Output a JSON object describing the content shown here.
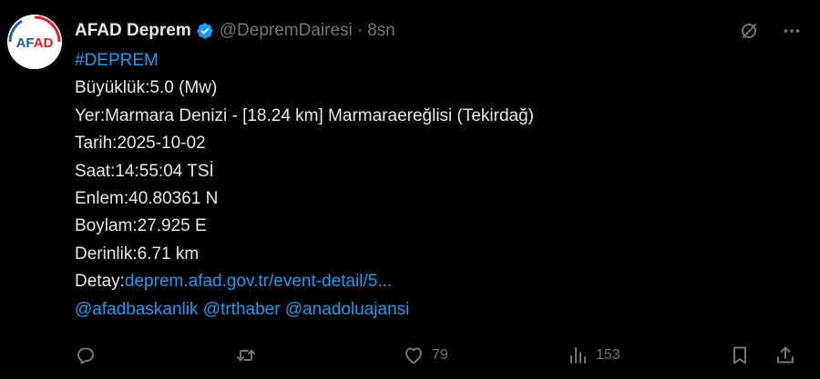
{
  "author": {
    "avatar_text": "AFAD",
    "display_name": "AFAD Deprem",
    "handle": "@DepremDairesi",
    "separator": "·",
    "time": "8sn"
  },
  "tweet": {
    "hashtag": "#DEPREM",
    "magnitude": "Büyüklük:5.0 (Mw)",
    "location": "Yer:Marmara Denizi - [18.24 km] Marmaraereğlisi (Tekirdağ)",
    "date": "Tarih:2025-10-02",
    "time": "Saat:14:55:04 TSİ",
    "latitude": "Enlem:40.80361 N",
    "longitude": "Boylam:27.925 E",
    "depth": "Derinlik:6.71 km",
    "detail_label": "Detay:",
    "detail_link": "deprem.afad.gov.tr/event-detail/5...",
    "mentions": [
      "@afadbaskanlik",
      "@trthaber",
      "@anadoluajansi"
    ]
  },
  "metrics": {
    "likes": "79",
    "views": "153"
  },
  "colors": {
    "background": "#000000",
    "text": "#e7e9ea",
    "muted": "#71767b",
    "link": "#1d9bf0",
    "brand_blue": "#1d5ea8",
    "brand_red": "#e11e25"
  },
  "icons": [
    "verified-badge-icon",
    "grok-icon",
    "more-icon",
    "reply-icon",
    "retweet-icon",
    "like-icon",
    "views-icon",
    "bookmark-icon",
    "share-icon"
  ]
}
